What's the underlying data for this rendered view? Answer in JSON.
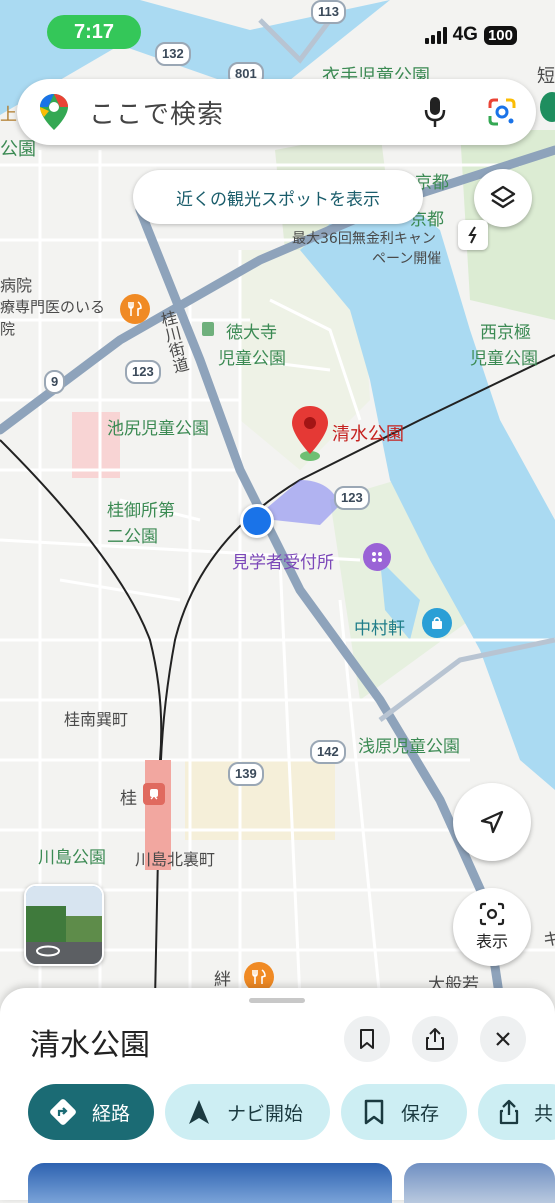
{
  "status_bar": {
    "time": "7:17",
    "network": "4G",
    "battery": "100"
  },
  "search": {
    "placeholder": "ここで検索"
  },
  "suggestion_chip": {
    "label": "近くの観光スポットを表示"
  },
  "map_labels": {
    "kamo_park": "衣手児童公園",
    "kyoto_top": "ム京都",
    "kyoto2": "京都",
    "campaign1": "最大36回無金利キャン",
    "campaign2": "ペーン開催",
    "hospital": "病院",
    "clinic": "療専門医のいる",
    "clinic2": "院",
    "katsura_road": "桂川街道",
    "tokudaiji1": "徳大寺",
    "tokudaiji2": "児童公園",
    "nishikyogoku1": "西京極",
    "nishikyogoku2": "児童公園",
    "ikejiri": "池尻児童公園",
    "shimizu": "清水公園",
    "katsura_gosho1": "桂御所第",
    "katsura_gosho2": "二公園",
    "visitor": "見学者受付所",
    "nakamuraken": "中村軒",
    "katsura_minami": "桂南巽町",
    "asahara": "浅原児童公園",
    "katsura_station": "桂",
    "kawashima_park": "川島公園",
    "kawashima_kita": "川島北裏町",
    "kizuna": "絆",
    "daihannya": "大般若",
    "edge_top_right": "短",
    "edge_left": "上",
    "edge_park": "公園",
    "edge_right": "キ"
  },
  "road_shields": [
    "113",
    "132",
    "801",
    "9",
    "123",
    "123",
    "142",
    "139"
  ],
  "buttons": {
    "show_label": "表示"
  },
  "place_sheet": {
    "title": "清水公園",
    "actions": {
      "directions": "経路",
      "start_navigation": "ナビ開始",
      "save": "保存",
      "share_partial": "共"
    }
  },
  "colors": {
    "river": "#aadaf2",
    "road_main": "#8ea3bb",
    "accent_teal": "#1b6b74",
    "pin_red": "#e53935",
    "location_blue": "#1a73e8",
    "status_green": "#34c759"
  }
}
